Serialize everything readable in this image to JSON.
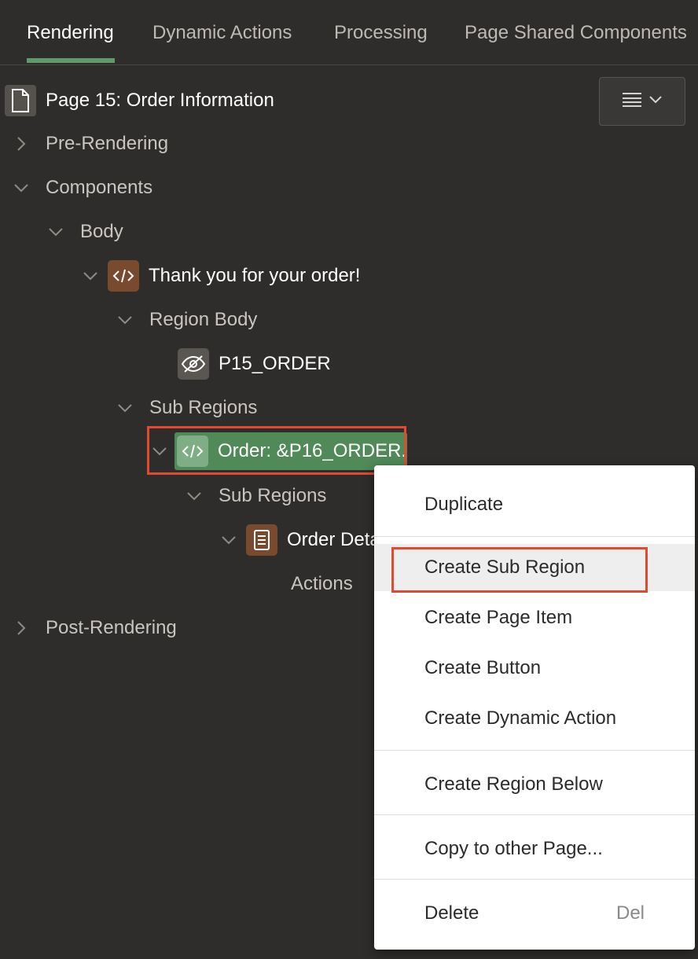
{
  "tabs": [
    "Rendering",
    "Dynamic Actions",
    "Processing",
    "Page Shared Components"
  ],
  "page_title": "Page 15: Order Information",
  "tree": {
    "pre_rendering": "Pre-Rendering",
    "components": "Components",
    "body": "Body",
    "region_thanks": "Thank you for your order!",
    "region_body": "Region Body",
    "item_p15_order": "P15_ORDER",
    "sub_regions_1": "Sub Regions",
    "region_order": "Order: &P16_ORDER.",
    "sub_regions_2": "Sub Regions",
    "region_order_details": "Order Deta",
    "actions": "Actions",
    "post_rendering": "Post-Rendering"
  },
  "context_menu": {
    "duplicate": "Duplicate",
    "create_sub_region": "Create Sub Region",
    "create_page_item": "Create Page Item",
    "create_button": "Create Button",
    "create_dynamic_action": "Create Dynamic Action",
    "create_region_below": "Create Region Below",
    "copy_to_other_page": "Copy to other Page...",
    "delete": "Delete",
    "delete_shortcut": "Del"
  },
  "colors": {
    "background": "#2f2d2b",
    "active_tab_underline": "#5f9a68",
    "selected_node": "#4f8a58",
    "static_content_icon": "#7a4a2e",
    "highlight_box": "#e04a35"
  },
  "icons": [
    "page-icon",
    "hamburger-menu-icon",
    "chevron-right-icon",
    "chevron-down-icon",
    "code-icon",
    "hidden-eye-icon",
    "report-icon"
  ]
}
